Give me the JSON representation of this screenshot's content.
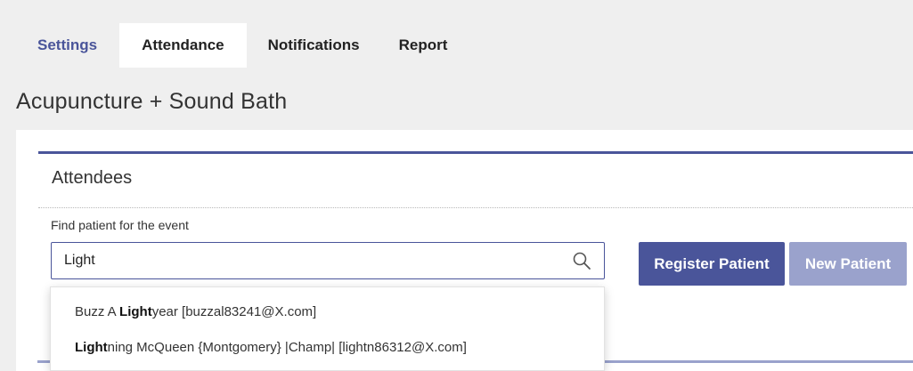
{
  "tabs": [
    {
      "label": "Settings"
    },
    {
      "label": "Attendance"
    },
    {
      "label": "Notifications"
    },
    {
      "label": "Report"
    }
  ],
  "active_tab": "Attendance",
  "page_title": "Acupuncture + Sound Bath",
  "attendees": {
    "title": "Attendees",
    "find_label": "Find patient for the event",
    "search_value": "Light",
    "register_button": "Register Patient",
    "new_button": "New Patient"
  },
  "suggestions": [
    {
      "before": "Buzz A ",
      "match": "Light",
      "after": "year [buzzal83241@X.com]"
    },
    {
      "before": "",
      "match": "Light",
      "after": "ning McQueen {Montgomery} |Champ| [lightn86312@X.com]"
    }
  ],
  "colors": {
    "accent": "#4a559a",
    "accent_light": "#9aa2cc",
    "background": "#efefef"
  },
  "icons": {
    "search": "magnifier"
  }
}
